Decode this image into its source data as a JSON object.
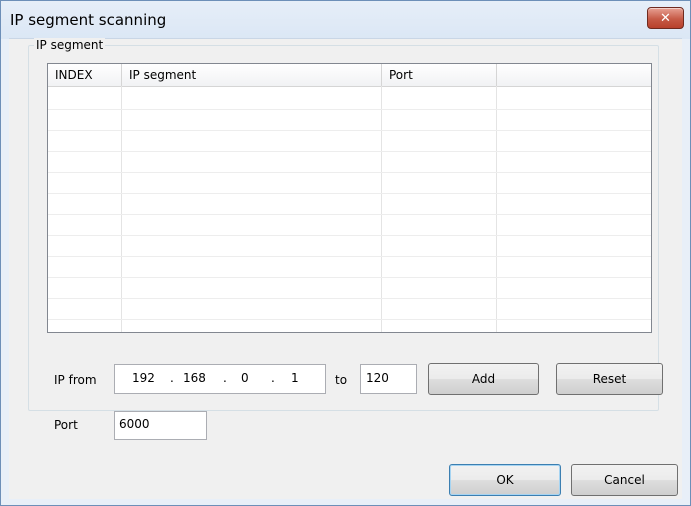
{
  "window": {
    "title": "IP segment scanning",
    "close_glyph": "✕",
    "close_icon": "close-icon"
  },
  "group": {
    "legend": "IP segment"
  },
  "list": {
    "columns": [
      "INDEX",
      "IP segment",
      "Port",
      ""
    ],
    "rows": []
  },
  "form": {
    "ip_from_label": "IP from",
    "ip_octets": [
      "192",
      "168",
      "0",
      "1"
    ],
    "ip_dot": ".",
    "to_label": "to",
    "to_value": "120",
    "port_label": "Port",
    "port_value": "6000"
  },
  "buttons": {
    "add": "Add",
    "reset": "Reset",
    "ok": "OK",
    "cancel": "Cancel"
  },
  "colors": {
    "title_bar": "#dbe7f5",
    "close_button": "#c65a46",
    "dialog_body": "#f0f0f0"
  }
}
